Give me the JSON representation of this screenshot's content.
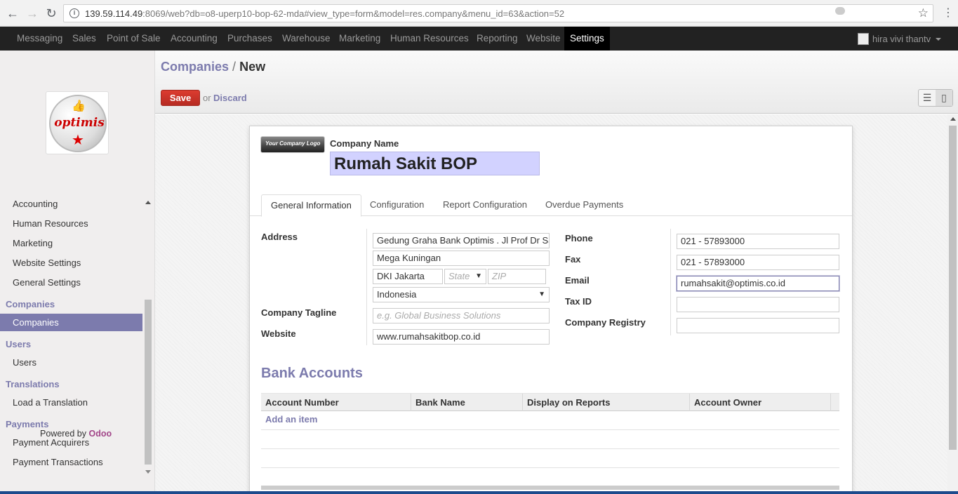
{
  "browser": {
    "url_host": "139.59.114.49",
    "url_rest": ":8069/web?db=o8-uperp10-bop-62-mda#view_type=form&model=res.company&menu_id=63&action=52"
  },
  "topbar": {
    "menus": [
      "Messaging",
      "Sales",
      "Point of Sale",
      "Accounting",
      "Purchases",
      "Warehouse",
      "Marketing",
      "Human Resources",
      "Reporting",
      "Website",
      "Settings"
    ],
    "active_menu": "Settings",
    "user_name": "hira vivi thantv"
  },
  "sidebar": {
    "logo_text": "optimis",
    "items_top": [
      "Accounting",
      "Human Resources",
      "Marketing",
      "Website Settings",
      "General Settings"
    ],
    "sections": [
      {
        "header": "Companies",
        "items": [
          "Companies"
        ]
      },
      {
        "header": "Users",
        "items": [
          "Users"
        ]
      },
      {
        "header": "Translations",
        "items": [
          "Load a Translation"
        ]
      },
      {
        "header": "Payments",
        "items": [
          "Payment Acquirers",
          "Payment Transactions"
        ]
      }
    ],
    "active_item": "Companies",
    "powered_by": "Powered by",
    "brand": "Odoo"
  },
  "control": {
    "breadcrumb_parent": "Companies",
    "breadcrumb_sep": "/",
    "breadcrumb_current": "New",
    "save_label": "Save",
    "or_label": "or",
    "discard_label": "Discard"
  },
  "form": {
    "logo_text": "Your Company Logo",
    "company_name_label": "Company Name",
    "company_name": "Rumah Sakit BOP",
    "tabs": [
      "General Information",
      "Configuration",
      "Report Configuration",
      "Overdue Payments"
    ],
    "active_tab": "General Information",
    "labels": {
      "address": "Address",
      "tagline": "Company Tagline",
      "website": "Website",
      "phone": "Phone",
      "fax": "Fax",
      "email": "Email",
      "tax_id": "Tax ID",
      "registry": "Company Registry"
    },
    "values": {
      "street": "Gedung Graha Bank Optimis . Jl Prof Dr Satrio",
      "street2": "Mega Kuningan",
      "city": "DKI Jakarta",
      "state_placeholder": "State",
      "zip_placeholder": "ZIP",
      "country": "Indonesia",
      "tagline_placeholder": "e.g. Global Business Solutions",
      "website": "www.rumahsakitbop.co.id",
      "phone": "021 - 57893000",
      "fax": "021 - 57893000",
      "email": "rumahsakit@optimis.co.id",
      "tax_id": "",
      "registry": ""
    },
    "bank": {
      "title": "Bank Accounts",
      "columns": [
        "Account Number",
        "Bank Name",
        "Display on Reports",
        "Account Owner"
      ],
      "add_item": "Add an item"
    }
  }
}
